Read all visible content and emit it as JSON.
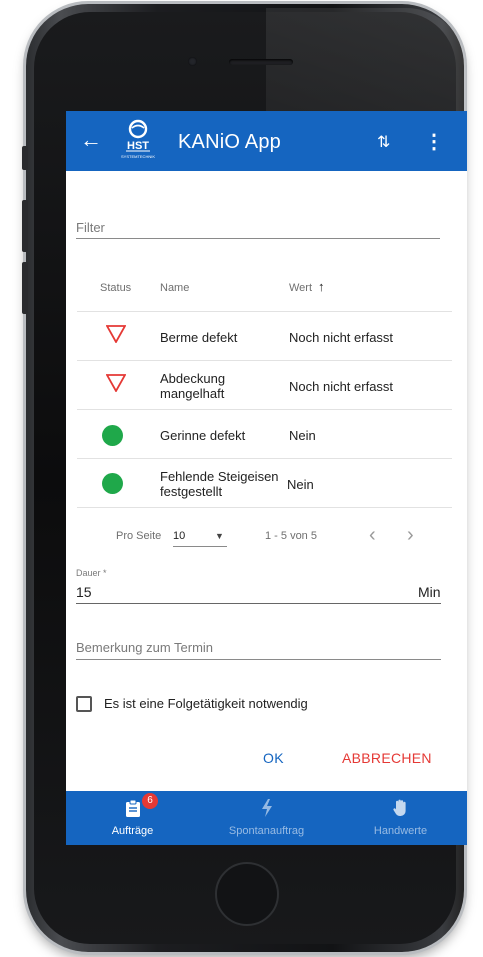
{
  "appbar": {
    "title": "KANiO App",
    "logo_text": "HST",
    "logo_subtext": "SYSTEMTECHNIK"
  },
  "filter": {
    "label": "Filter"
  },
  "table": {
    "headers": [
      "Status",
      "Name",
      "Wert"
    ],
    "sort_indicator": "↑",
    "rows": [
      {
        "status": "triangle-warning",
        "name_line1": "Berme defekt",
        "name_line2": "",
        "value": "Noch nicht erfasst"
      },
      {
        "status": "triangle-warning",
        "name_line1": "Abdeckung",
        "name_line2": "mangelhaft",
        "value": "Noch nicht erfasst"
      },
      {
        "status": "ok-dot",
        "name_line1": "Gerinne defekt",
        "name_line2": "",
        "value": "Nein"
      },
      {
        "status": "ok-dot",
        "name_line1": "Fehlende Steigeisen",
        "name_line2": "festgestellt",
        "value": "Nein"
      }
    ],
    "pager": {
      "per_page_label": "Pro Seite",
      "per_page_value": "10",
      "range": "1 - 5 von 5",
      "prev": "‹",
      "next": "›"
    }
  },
  "duration": {
    "label": "Dauer *",
    "value": "15",
    "unit": "Min"
  },
  "remark": {
    "placeholder": "Bemerkung zum Termin"
  },
  "followup": {
    "label": "Es ist eine Folgetätigkeit notwendig",
    "checked": false
  },
  "actions": {
    "ok": "OK",
    "cancel": "ABBRECHEN"
  },
  "bottom_nav": {
    "items": [
      {
        "label": "Aufträge",
        "icon": "clipboard-icon",
        "badge": "6",
        "active": true
      },
      {
        "label": "Spontanauftrag",
        "icon": "lightning-icon",
        "active": false
      },
      {
        "label": "Handwerte",
        "icon": "hand-icon",
        "active": false
      }
    ]
  },
  "colors": {
    "primary": "#1565c0",
    "warning": "#e53935",
    "ok": "#1fa84a",
    "cancel": "#e53935"
  }
}
